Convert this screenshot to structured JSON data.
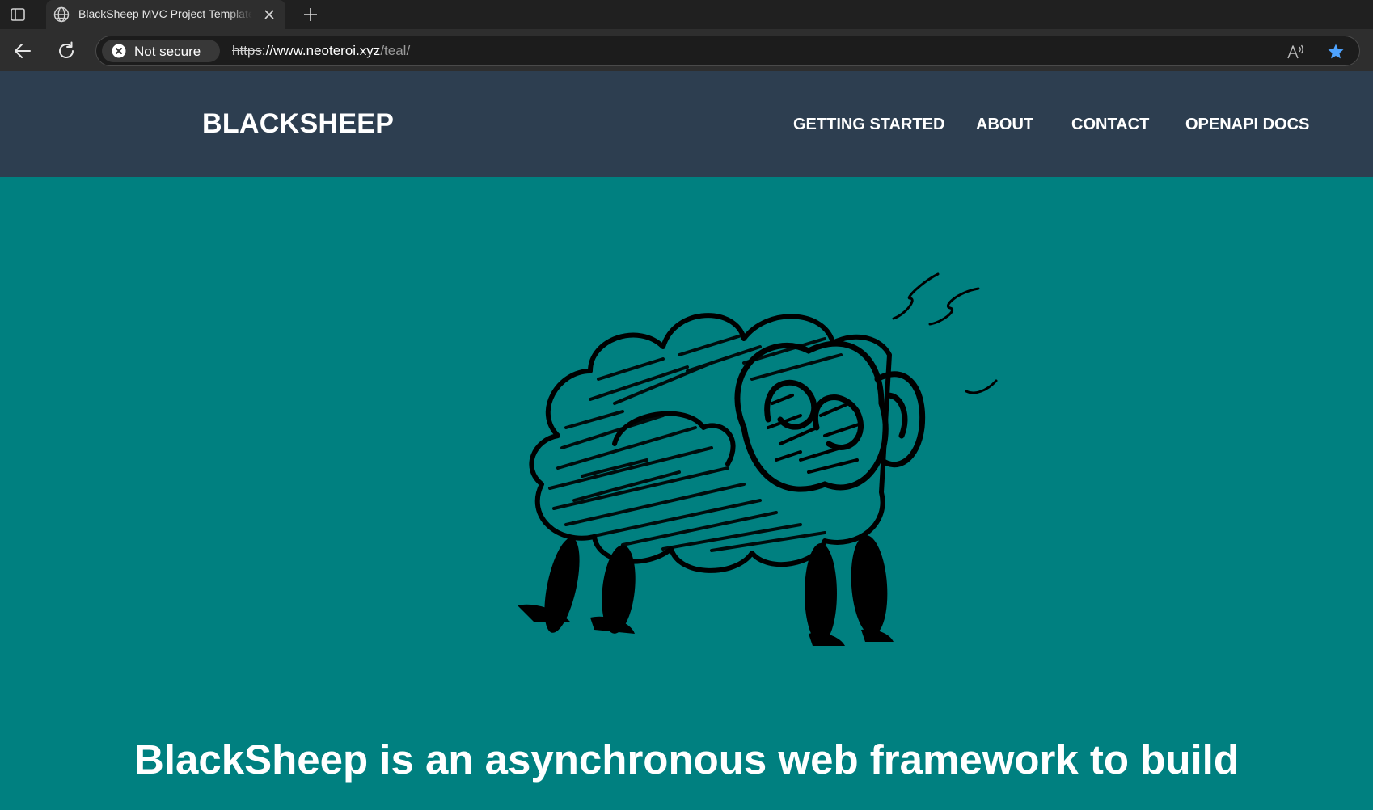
{
  "browser": {
    "tab": {
      "title": "BlackSheep MVC Project Template"
    },
    "security_label": "Not secure",
    "url": {
      "scheme": "https",
      "host": "://www.neoteroi.xyz",
      "path": "/teal/"
    },
    "accent": "#4ea3ff"
  },
  "site": {
    "brand": "BLACKSHEEP",
    "nav": [
      {
        "label": "GETTING STARTED"
      },
      {
        "label": "ABOUT"
      },
      {
        "label": "CONTACT"
      },
      {
        "label": "OPENAPI DOCS"
      }
    ],
    "headline": "BlackSheep is an asynchronous web framework to build",
    "colors": {
      "header": "#2d3e50",
      "hero": "#008080"
    },
    "hero_image": "black-sheep-sketch-icon"
  }
}
